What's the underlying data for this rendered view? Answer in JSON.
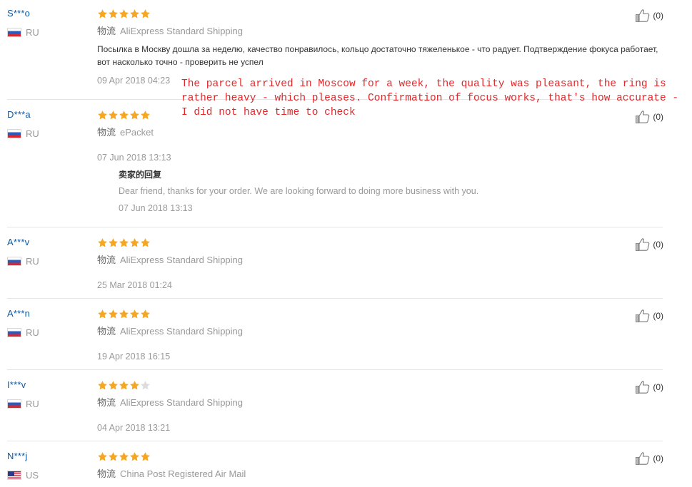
{
  "reviews": [
    {
      "name": "S***o",
      "country": "RU",
      "flag": "ru",
      "rating": 5,
      "shipping_label": "物流",
      "shipping": "AliExpress Standard Shipping",
      "text": "Посылка в Москву дошла за неделю, качество понравилось, кольцо достаточно тяжеленькое - что радует. Подтверждение фокуса работает, вот насколько точно - проверить не успел",
      "date": "09 Apr 2018 04:23",
      "likes": "(0)"
    },
    {
      "name": "D***a",
      "country": "RU",
      "flag": "ru",
      "rating": 5,
      "shipping_label": "物流",
      "shipping": "ePacket",
      "text": "",
      "date": "07 Jun 2018 13:13",
      "likes": "(0)",
      "seller_reply": {
        "title": "卖家的回复",
        "text": "Dear friend, thanks for your order. We are looking forward to doing more business with you.",
        "date": "07 Jun 2018 13:13"
      }
    },
    {
      "name": "A***v",
      "country": "RU",
      "flag": "ru",
      "rating": 5,
      "shipping_label": "物流",
      "shipping": "AliExpress Standard Shipping",
      "text": "",
      "date": "25 Mar 2018 01:24",
      "likes": "(0)"
    },
    {
      "name": "A***n",
      "country": "RU",
      "flag": "ru",
      "rating": 5,
      "shipping_label": "物流",
      "shipping": "AliExpress Standard Shipping",
      "text": "",
      "date": "19 Apr 2018 16:15",
      "likes": "(0)"
    },
    {
      "name": "I***v",
      "country": "RU",
      "flag": "ru",
      "rating": 4,
      "shipping_label": "物流",
      "shipping": "AliExpress Standard Shipping",
      "text": "",
      "date": "04 Apr 2018 13:21",
      "likes": "(0)"
    },
    {
      "name": "N***j",
      "country": "US",
      "flag": "us",
      "rating": 5,
      "shipping_label": "物流",
      "shipping": "China Post Registered Air Mail",
      "text": "",
      "date": "",
      "likes": "(0)"
    }
  ],
  "translation_note": "The parcel arrived in Moscow for a week, the quality was pleasant, the ring is rather heavy - which pleases. Confirmation of focus works, that's how accurate - I did not have time to check",
  "colors": {
    "star_filled": "#f5a623",
    "star_empty": "#dddddd",
    "username": "#0a5aa8",
    "translation": "#e0282b"
  }
}
